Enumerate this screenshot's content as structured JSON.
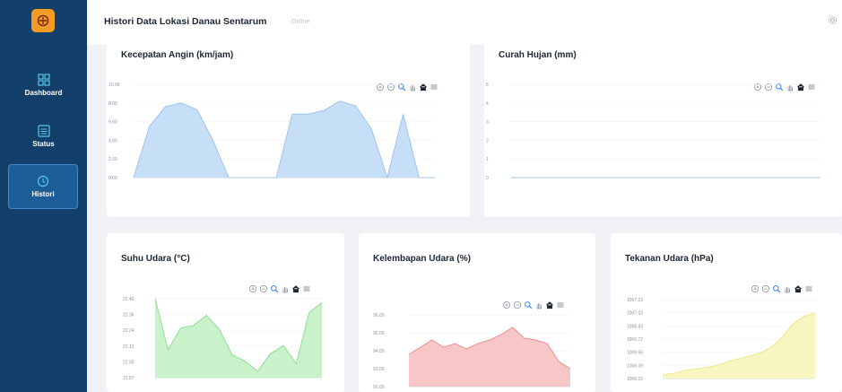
{
  "app": {
    "brand_color": "#f39a25",
    "sidebar_color": "#13406a"
  },
  "sidebar": {
    "items": [
      {
        "label": "Dashboard",
        "icon": "grid-icon"
      },
      {
        "label": "Status",
        "icon": "list-icon"
      },
      {
        "label": "Histori",
        "icon": "history-icon",
        "active": true
      }
    ]
  },
  "header": {
    "title": "Histori Data Lokasi Danau Sentarum",
    "status": "Online"
  },
  "chart_data": [
    {
      "type": "area",
      "title": "Kecepatan Angin (km/jam)",
      "color": "#bcd8f5",
      "stroke": "#9dc4ee",
      "yticks": [
        "10.00",
        "8.00",
        "6.00",
        "4.00",
        "2.00",
        "0.00"
      ],
      "ylim": [
        0,
        10
      ],
      "values": [
        0,
        5.5,
        7.6,
        8.0,
        7.3,
        4.0,
        0,
        0,
        0,
        0,
        6.8,
        6.8,
        7.2,
        8.2,
        7.7,
        5.2,
        0,
        6.8,
        0,
        0
      ]
    },
    {
      "type": "area",
      "title": "Curah Hujan (mm)",
      "color": "#bcd8f5",
      "stroke": "#9dc4ee",
      "yticks": [
        "5",
        "4",
        "3",
        "2",
        "1",
        "0"
      ],
      "ylim": [
        0,
        5
      ],
      "values": [
        0,
        0,
        0,
        0,
        0,
        0,
        0,
        0,
        0,
        0,
        0,
        0,
        0,
        0,
        0,
        0,
        0,
        0,
        0,
        0
      ]
    },
    {
      "type": "area",
      "title": "Suhu Udara (°C)",
      "color": "#bff0c2",
      "stroke": "#8fde94",
      "yticks": [
        "22.49",
        "22.36",
        "22.24",
        "22.12",
        "22.00",
        "21.87"
      ],
      "ylim": [
        21.87,
        22.49
      ],
      "values": [
        22.49,
        22.09,
        22.26,
        22.28,
        22.36,
        22.25,
        22.05,
        22.0,
        21.92,
        22.06,
        22.12,
        21.98,
        22.38,
        22.46
      ]
    },
    {
      "type": "area",
      "title": "Kelembapan Udara (%)",
      "color": "#f6bcbc",
      "stroke": "#ee8f8f",
      "yticks": [
        "96.00",
        "95.00",
        "94.00",
        "93.00",
        "92.00"
      ],
      "ylim": [
        92,
        96
      ],
      "values": [
        93.8,
        94.2,
        94.6,
        94.2,
        94.4,
        94.1,
        94.4,
        94.6,
        94.9,
        95.3,
        94.7,
        94.6,
        94.4,
        93.4,
        93.0
      ]
    },
    {
      "type": "area",
      "title": "Tekanan Udara (hPa)",
      "color": "#f6f5b6",
      "stroke": "#ebe886",
      "yticks": [
        "1007.23",
        "1007.03",
        "1006.83",
        "1006.72",
        "1006.56",
        "1006.39",
        "1006.22"
      ],
      "ylim": [
        1006.15,
        1007.23
      ],
      "values": [
        1006.2,
        1006.22,
        1006.26,
        1006.28,
        1006.3,
        1006.33,
        1006.38,
        1006.42,
        1006.46,
        1006.5,
        1006.58,
        1006.72,
        1006.9,
        1007.0,
        1007.05
      ]
    }
  ]
}
